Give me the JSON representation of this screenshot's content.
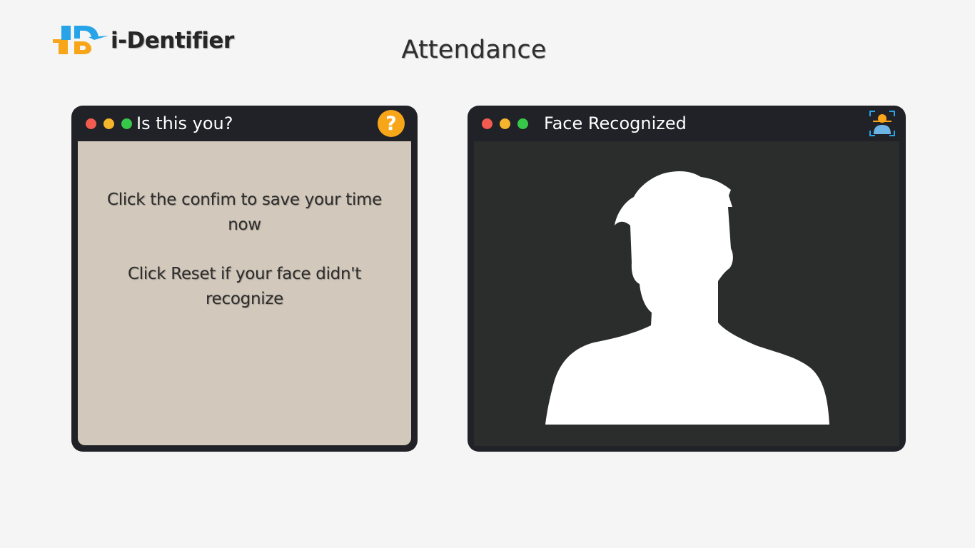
{
  "brand": {
    "name": "i-Dentifier",
    "logo_icon": "id-logo-icon",
    "colors": {
      "blue": "#27a4e8",
      "orange": "#f7a519"
    }
  },
  "page": {
    "title": "Attendance"
  },
  "confirm_panel": {
    "title": "Is this you?",
    "help_icon": "help-question-icon",
    "help_label": "?",
    "instruction_1": "Click the confim to save your time now",
    "instruction_2": "Click Reset if your face didn't recognize"
  },
  "camera_panel": {
    "title": "Face Recognized",
    "icon": "face-scan-icon",
    "preview_icon": "person-silhouette-icon"
  },
  "window_controls": {
    "close_color": "#f25b50",
    "minimize_color": "#f4b42c",
    "maximize_color": "#37c84a"
  },
  "colors": {
    "background": "#f5f5f5",
    "window_frame": "#212227",
    "confirm_content": "#d2c8bb",
    "camera_content": "#2a2d2c"
  }
}
